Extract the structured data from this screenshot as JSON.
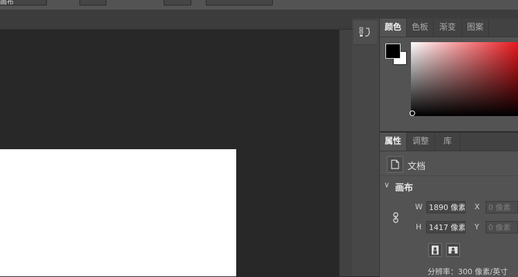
{
  "options_bar": {
    "dropdown_value": "画布"
  },
  "color_panel": {
    "tabs": [
      "颜色",
      "色板",
      "渐变",
      "图案"
    ],
    "active_tab": "颜色",
    "foreground_color": "#000000",
    "background_color": "#ffffff",
    "hue_color": "#e8181d"
  },
  "dock": {
    "collapse_label": "‹‹"
  },
  "properties_panel": {
    "tabs": [
      "属性",
      "调整",
      "库"
    ],
    "active_tab": "属性",
    "doc_label": "文档",
    "section_title": "画布",
    "width_label": "W",
    "width_value": "1890 像素",
    "height_label": "H",
    "height_value": "1417 像素",
    "x_label": "X",
    "x_value": "0 像素",
    "y_label": "Y",
    "y_value": "0 像素",
    "resolution": "分辨率：300 像素/英寸"
  }
}
